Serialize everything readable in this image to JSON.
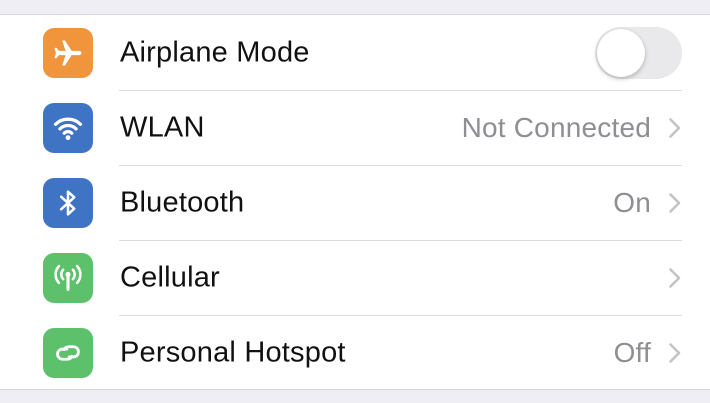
{
  "colors": {
    "airplane_icon_bg": "#f0953c",
    "wlan_icon_bg": "#3f73c3",
    "bluetooth_icon_bg": "#3f73c3",
    "cellular_icon_bg": "#5cc16a",
    "hotspot_icon_bg": "#5cc16a",
    "toggle_off": "#e9e9eb",
    "value_text": "#8e8e93"
  },
  "settings": {
    "rows": [
      {
        "label": "Airplane Mode",
        "icon": "airplane-icon",
        "control": "toggle",
        "toggle_on": false
      },
      {
        "label": "WLAN",
        "icon": "wifi-icon",
        "value": "Not Connected",
        "control": "chevron"
      },
      {
        "label": "Bluetooth",
        "icon": "bluetooth-icon",
        "value": "On",
        "control": "chevron"
      },
      {
        "label": "Cellular",
        "icon": "cellular-antenna-icon",
        "value": "",
        "control": "chevron"
      },
      {
        "label": "Personal Hotspot",
        "icon": "personal-hotspot-icon",
        "value": "Off",
        "control": "chevron"
      }
    ]
  }
}
